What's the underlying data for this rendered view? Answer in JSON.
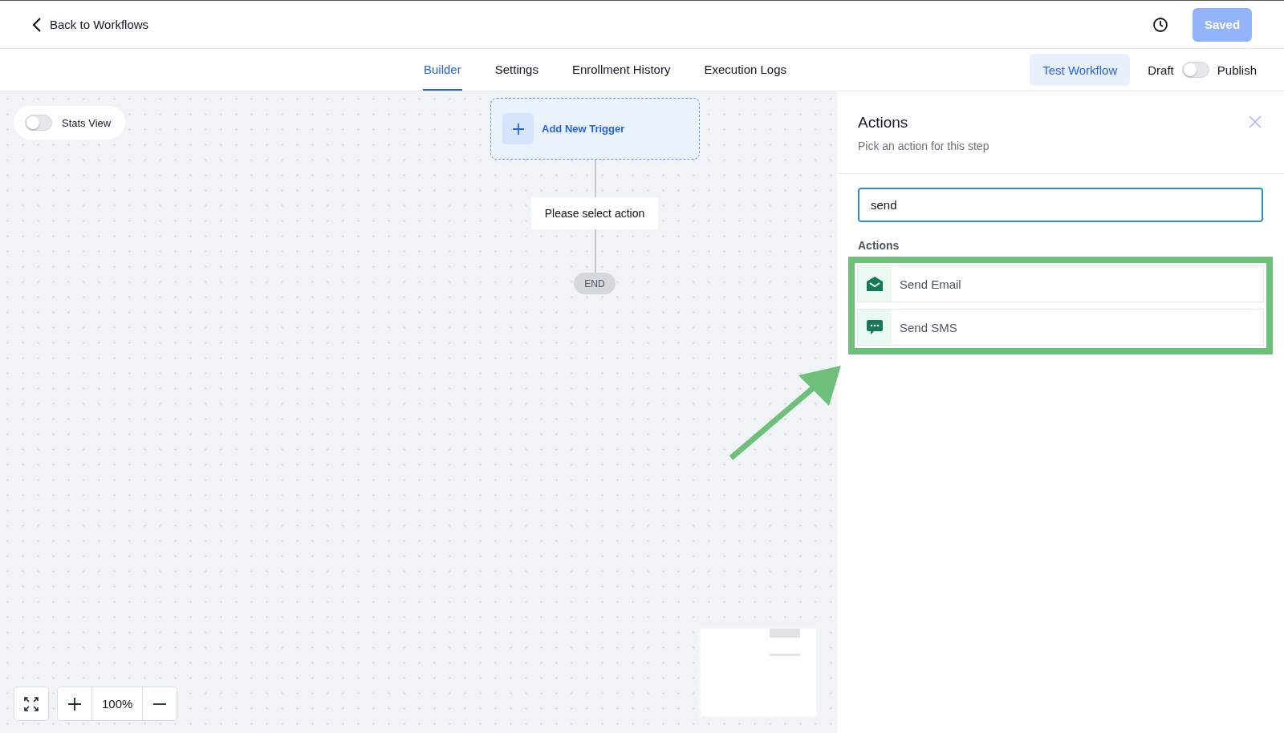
{
  "header": {
    "back_link": "Back to Workflows",
    "save_button": {
      "label": "Saved",
      "disabled": true
    }
  },
  "tabs": [
    {
      "label": "Builder",
      "selected": true
    },
    {
      "label": "Settings",
      "selected": false
    },
    {
      "label": "Enrollment History",
      "selected": false
    },
    {
      "label": "Execution Logs",
      "selected": false
    }
  ],
  "toolbar": {
    "test_button": "Test Workflow",
    "draft_label": "Draft",
    "publish_toggle": {
      "on": false
    },
    "publish_label": "Publish"
  },
  "canvas": {
    "stats_toggle": {
      "label": "Stats View",
      "on": false
    },
    "trigger_node": "Add New Trigger",
    "action_node": "Please select action",
    "end_node": "END",
    "zoom_level": "100%"
  },
  "panel": {
    "title": "Actions",
    "subtitle": "Pick an action for this step",
    "search": {
      "value": "send"
    },
    "section_label": "Actions",
    "items": [
      {
        "kind": "email",
        "label": "Send Email"
      },
      {
        "kind": "sms",
        "label": "Send SMS"
      }
    ]
  }
}
